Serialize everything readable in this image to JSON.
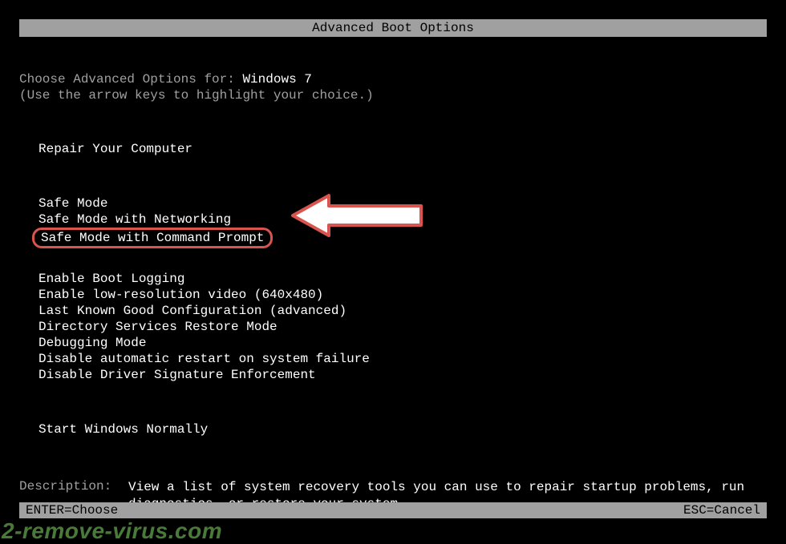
{
  "header": {
    "title": "Advanced Boot Options"
  },
  "choose": {
    "prefix": "Choose Advanced Options for: ",
    "os": "Windows 7"
  },
  "hint": "(Use the arrow keys to highlight your choice.)",
  "menu": {
    "repair": "Repair Your Computer",
    "safe_mode": "Safe Mode",
    "safe_mode_net": "Safe Mode with Networking",
    "safe_mode_cmd": "Safe Mode with Command Prompt",
    "boot_logging": "Enable Boot Logging",
    "low_res": "Enable low-resolution video (640x480)",
    "last_known": "Last Known Good Configuration (advanced)",
    "ds_restore": "Directory Services Restore Mode",
    "debugging": "Debugging Mode",
    "disable_restart": "Disable automatic restart on system failure",
    "disable_sig": "Disable Driver Signature Enforcement",
    "start_normal": "Start Windows Normally"
  },
  "description": {
    "label": "Description:",
    "text": "View a list of system recovery tools you can use to repair startup problems, run diagnostics, or restore your system."
  },
  "footer": {
    "enter": "ENTER=Choose",
    "esc": "ESC=Cancel"
  },
  "watermark": "2-remove-virus.com"
}
